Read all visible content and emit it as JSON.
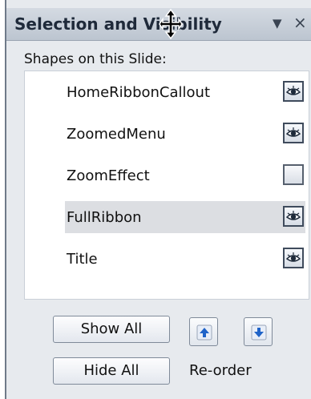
{
  "pane": {
    "title": "Selection and Visibility",
    "heading": "Shapes on this Slide:"
  },
  "shapes": [
    {
      "name": "HomeRibbonCallout",
      "visible": true,
      "selected": false
    },
    {
      "name": "ZoomedMenu",
      "visible": true,
      "selected": false
    },
    {
      "name": "ZoomEffect",
      "visible": false,
      "selected": false
    },
    {
      "name": "FullRibbon",
      "visible": true,
      "selected": true
    },
    {
      "name": "Title",
      "visible": true,
      "selected": false
    }
  ],
  "buttons": {
    "show_all": "Show All",
    "hide_all": "Hide All",
    "reorder": "Re-order"
  },
  "icons": {
    "move_cursor": "move-cursor-icon",
    "dropdown": "dropdown-icon",
    "close": "close-icon",
    "eye": "eye-icon",
    "up": "arrow-up-icon",
    "down": "arrow-down-icon"
  },
  "colors": {
    "selection_bg": "#dcdee2",
    "accent_blue": "#1f63c8"
  }
}
